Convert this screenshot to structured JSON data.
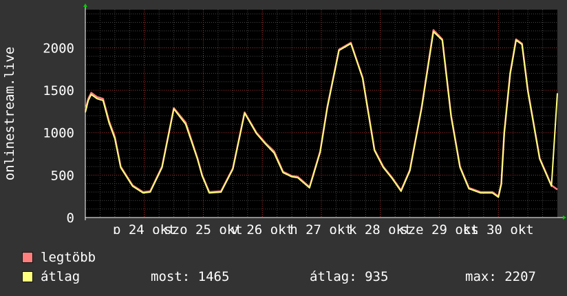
{
  "chart_data": {
    "type": "line",
    "ylabel": "onlinestream.live",
    "ylim": [
      0,
      2450
    ],
    "yticks": [
      0,
      500,
      1000,
      1500,
      2000
    ],
    "xlabels": [
      "p 24 okt",
      "szo 25 okt",
      "v 26 okt",
      "h 27 okt",
      "k 28 okt",
      "sze 29 okt",
      "cs 30 okt"
    ],
    "grid": true,
    "series": [
      {
        "name": "legtöbb",
        "color": "#ff7f7f",
        "x": [
          0,
          0.05,
          0.1,
          0.2,
          0.3,
          0.4,
          0.5,
          0.6,
          0.8,
          0.98,
          1.1,
          1.3,
          1.5,
          1.7,
          1.9,
          1.98,
          2.1,
          2.3,
          2.5,
          2.7,
          2.9,
          3.05,
          3.2,
          3.35,
          3.5,
          3.6,
          3.8,
          3.98,
          4.1,
          4.3,
          4.5,
          4.7,
          4.9,
          5.05,
          5.2,
          5.35,
          5.5,
          5.7,
          5.9,
          6.05,
          6.2,
          6.35,
          6.5,
          6.7,
          6.9,
          7.0,
          7.05,
          7.1,
          7.2,
          7.3,
          7.4,
          7.5,
          7.7,
          7.9,
          8.0
        ],
        "y": [
          1260,
          1400,
          1470,
          1420,
          1400,
          1140,
          950,
          600,
          380,
          300,
          310,
          600,
          1290,
          1120,
          700,
          500,
          300,
          310,
          580,
          1240,
          1000,
          880,
          780,
          540,
          490,
          480,
          360,
          780,
          1300,
          1980,
          2060,
          1650,
          800,
          600,
          470,
          320,
          560,
          1300,
          2210,
          2100,
          1200,
          600,
          350,
          300,
          300,
          250,
          400,
          1000,
          1700,
          2100,
          2050,
          1500,
          700,
          380,
          330
        ]
      },
      {
        "name": "átlag",
        "color": "#ffff7f",
        "x": [
          0,
          0.05,
          0.1,
          0.2,
          0.3,
          0.4,
          0.5,
          0.6,
          0.8,
          0.98,
          1.1,
          1.3,
          1.5,
          1.7,
          1.9,
          1.98,
          2.1,
          2.3,
          2.5,
          2.7,
          2.9,
          3.05,
          3.2,
          3.35,
          3.5,
          3.6,
          3.8,
          3.98,
          4.1,
          4.3,
          4.5,
          4.7,
          4.9,
          5.05,
          5.2,
          5.35,
          5.5,
          5.7,
          5.9,
          6.05,
          6.2,
          6.35,
          6.5,
          6.7,
          6.9,
          7.0,
          7.05,
          7.1,
          7.2,
          7.3,
          7.4,
          7.5,
          7.7,
          7.9,
          8.0
        ],
        "y": [
          1240,
          1380,
          1450,
          1400,
          1380,
          1120,
          930,
          590,
          370,
          290,
          300,
          590,
          1280,
          1100,
          690,
          490,
          290,
          300,
          570,
          1230,
          990,
          870,
          760,
          530,
          480,
          470,
          350,
          770,
          1290,
          1970,
          2050,
          1640,
          790,
          590,
          460,
          310,
          550,
          1290,
          2190,
          2090,
          1190,
          590,
          340,
          290,
          290,
          240,
          390,
          990,
          1690,
          2090,
          2040,
          1490,
          690,
          370,
          1465
        ]
      }
    ]
  },
  "legend": [
    {
      "label": "legtöbb",
      "color": "#ff7f7f"
    },
    {
      "label": "átlag",
      "color": "#ffff7f"
    }
  ],
  "stats": {
    "most": "most: 1465",
    "atlag": "átlag: 935",
    "max": "max: 2207"
  }
}
